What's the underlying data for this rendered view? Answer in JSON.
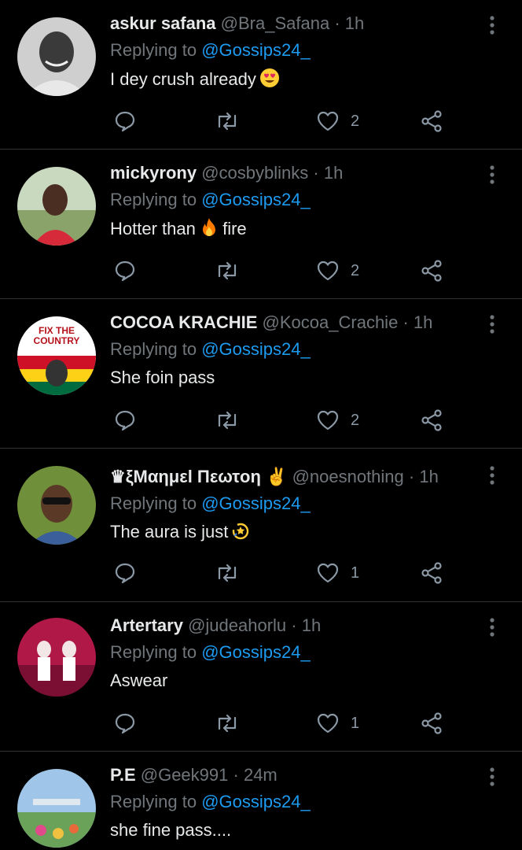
{
  "replies": [
    {
      "name": "askur safana",
      "handle": "@Bra_Safana",
      "sep": "·",
      "time": "1h",
      "replying_prefix": "Replying to",
      "mention": "@Gossips24_",
      "text": "I dey crush already",
      "emoji_icon": "heart-eyes-emoji",
      "likes": "2"
    },
    {
      "name": "mickyrony",
      "handle": "@cosbyblinks",
      "sep": "·",
      "time": "1h",
      "replying_prefix": "Replying to",
      "mention": "@Gossips24_",
      "text_a": "Hotter than",
      "emoji_icon": "fire-emoji",
      "text_b": "fire",
      "likes": "2"
    },
    {
      "name": "COCOA KRACHIE",
      "handle": "@Kocoa_Crachie",
      "sep": "·",
      "time": "1h",
      "replying_prefix": "Replying to",
      "mention": "@Gossips24_",
      "text": "She foin pass",
      "likes": "2",
      "avatar_text_1": "FIX THE",
      "avatar_text_2": "COUNTRY"
    },
    {
      "name": "♛ξΜαημεl Πεωτoη ✌",
      "handle": "@noesnothing",
      "sep": "·",
      "time": "1h",
      "replying_prefix": "Replying to",
      "mention": "@Gossips24_",
      "text": "The aura is just",
      "emoji_icon": "dizzy-emoji",
      "likes": "1"
    },
    {
      "name": "Artertary",
      "handle": "@judeahorlu",
      "sep": "·",
      "time": "1h",
      "replying_prefix": "Replying to",
      "mention": "@Gossips24_",
      "text": "Aswear",
      "likes": "1"
    },
    {
      "name": "P.E",
      "handle": "@Geek991",
      "sep": "·",
      "time": "24m",
      "replying_prefix": "Replying to",
      "mention": "@Gossips24_",
      "text": "she fine pass...."
    }
  ],
  "colors": {
    "background": "#000000",
    "link": "#1d9bf0",
    "muted": "#71767b",
    "divider": "#2f3336"
  }
}
